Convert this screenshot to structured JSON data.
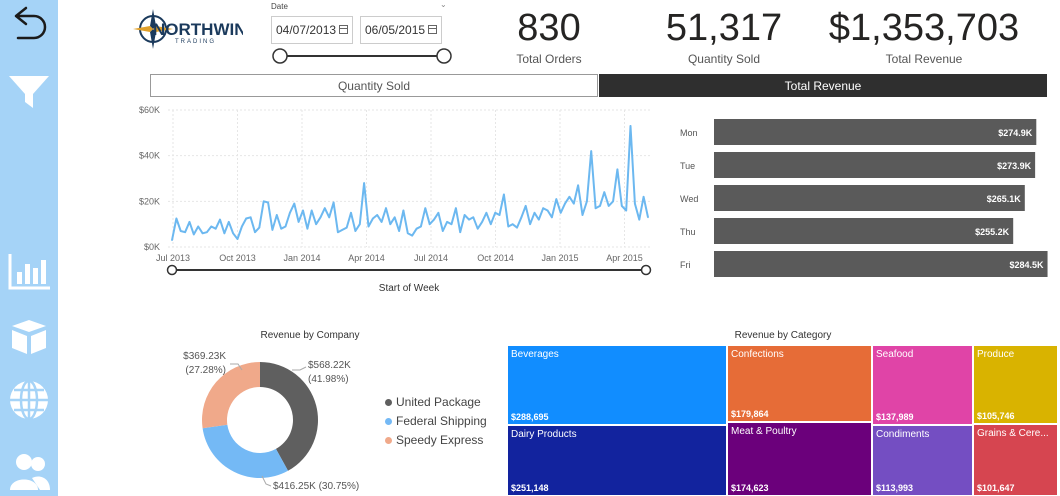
{
  "sidebar": {
    "items": [
      {
        "icon": "back-arrow-icon"
      },
      {
        "icon": "filter-icon"
      },
      {
        "icon": "bar-chart-icon"
      },
      {
        "icon": "box-icon"
      },
      {
        "icon": "globe-icon"
      },
      {
        "icon": "users-icon"
      }
    ]
  },
  "logo": {
    "text_main": "NORTHWIND",
    "text_sub": "TRADING"
  },
  "date_filter": {
    "label": "Date",
    "start": "04/07/2013",
    "end": "06/05/2015"
  },
  "kpis": [
    {
      "value": "830",
      "label": "Total Orders"
    },
    {
      "value": "51,317",
      "label": "Quantity Sold"
    },
    {
      "value": "$1,353,703",
      "label": "Total Revenue"
    }
  ],
  "toggle": {
    "left": "Quantity Sold",
    "right": "Total Revenue",
    "active": "right"
  },
  "colors": {
    "line": "#6cb8f0",
    "bar": "#5a5a5a",
    "sidebar": "#a5d3f7"
  },
  "chart_data": [
    {
      "type": "line",
      "xlabel": "Start of Week",
      "ylim": [
        0,
        60000
      ],
      "y_ticks": [
        "$0K",
        "$20K",
        "$40K",
        "$60K"
      ],
      "x_ticks": [
        "Jul 2013",
        "Oct 2013",
        "Jan 2014",
        "Apr 2014",
        "Jul 2014",
        "Oct 2014",
        "Jan 2015",
        "Apr 2015"
      ],
      "grid": true,
      "values": [
        3000,
        12500,
        7000,
        6500,
        11000,
        5500,
        9000,
        6000,
        6500,
        9000,
        8000,
        12000,
        6000,
        11000,
        6000,
        3500,
        9000,
        12500,
        13000,
        6500,
        8500,
        20000,
        19500,
        7500,
        14000,
        8000,
        9000,
        15000,
        19000,
        11000,
        16000,
        8000,
        16000,
        10000,
        13000,
        17000,
        13000,
        19500,
        6500,
        7500,
        8500,
        15000,
        7000,
        10000,
        28000,
        9000,
        12500,
        14000,
        11000,
        17000,
        10000,
        13000,
        7000,
        16000,
        6000,
        5000,
        8000,
        9000,
        17000,
        10000,
        12000,
        15000,
        7000,
        11000,
        10000,
        17000,
        6500,
        14000,
        12000,
        13000,
        8000,
        11000,
        15000,
        10000,
        15000,
        14000,
        23000,
        9000,
        10000,
        8500,
        13000,
        18000,
        10000,
        15000,
        12000,
        17000,
        16000,
        13000,
        21000,
        15000,
        19000,
        22000,
        19000,
        27000,
        14000,
        20000,
        42000,
        17000,
        18000,
        24000,
        18000,
        20000,
        34000,
        18000,
        16000,
        53000,
        19000,
        12000,
        22000,
        13000
      ]
    },
    {
      "type": "bar",
      "orientation": "horizontal",
      "categories": [
        "Mon",
        "Tue",
        "Wed",
        "Thu",
        "Fri"
      ],
      "values": [
        274.9,
        273.9,
        265.1,
        255.2,
        284.5
      ],
      "labels": [
        "$274.9K",
        "$273.9K",
        "$265.1K",
        "$255.2K",
        "$284.5K"
      ]
    },
    {
      "type": "pie",
      "title": "Revenue by Company",
      "slices": [
        {
          "name": "United Package",
          "value": 568.22,
          "label": "$568.22K",
          "pct": "(41.98%)",
          "color": "#5f5f5f"
        },
        {
          "name": "Federal Shipping",
          "value": 416.25,
          "label": "$416.25K (30.75%)",
          "pct": "",
          "color": "#74b9f5"
        },
        {
          "name": "Speedy Express",
          "value": 369.23,
          "label": "$369.23K",
          "pct": "(27.28%)",
          "color": "#f0a98a"
        }
      ]
    },
    {
      "type": "heatmap",
      "title": "Revenue by Category",
      "cells": [
        {
          "name": "Beverages",
          "value": "$288,695",
          "color": "#118dff"
        },
        {
          "name": "Dairy Products",
          "value": "$251,148",
          "color": "#12239e"
        },
        {
          "name": "Confections",
          "value": "$179,864",
          "color": "#e66c37"
        },
        {
          "name": "Meat & Poultry",
          "value": "$174,623",
          "color": "#6b007b"
        },
        {
          "name": "Seafood",
          "value": "$137,989",
          "color": "#e044a7"
        },
        {
          "name": "Condiments",
          "value": "$113,993",
          "color": "#744ec2"
        },
        {
          "name": "Produce",
          "value": "$105,746",
          "color": "#d9b300"
        },
        {
          "name": "Grains & Cere...",
          "value": "$101,647",
          "color": "#d64550"
        }
      ]
    }
  ]
}
